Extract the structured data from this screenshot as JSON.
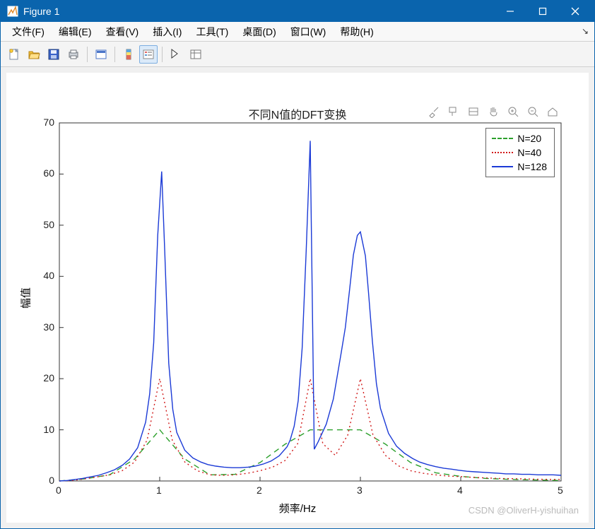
{
  "window": {
    "title": "Figure 1"
  },
  "menu": {
    "items": [
      "文件(F)",
      "编辑(E)",
      "查看(V)",
      "插入(I)",
      "工具(T)",
      "桌面(D)",
      "窗口(W)",
      "帮助(H)"
    ]
  },
  "toolbar": {
    "buttons": [
      {
        "name": "new-figure",
        "title": "New Figure"
      },
      {
        "name": "open",
        "title": "Open"
      },
      {
        "name": "save",
        "title": "Save"
      },
      {
        "name": "print",
        "title": "Print"
      },
      {
        "sep": true
      },
      {
        "name": "link-plot",
        "title": "Link Plot"
      },
      {
        "sep": true
      },
      {
        "name": "insert-colorbar",
        "title": "Insert Colorbar"
      },
      {
        "name": "insert-legend",
        "title": "Insert Legend",
        "active": true
      },
      {
        "sep": true
      },
      {
        "name": "edit-plot",
        "title": "Edit Plot"
      },
      {
        "name": "open-property-inspector",
        "title": "Open Property Inspector"
      }
    ]
  },
  "chart_data": {
    "type": "line",
    "title": "不同N值的DFT变换",
    "xlabel": "频率/Hz",
    "ylabel": "幅值",
    "xlim": [
      0,
      5
    ],
    "ylim": [
      0,
      70
    ],
    "xticks": [
      0,
      1,
      2,
      3,
      4,
      5
    ],
    "yticks": [
      0,
      10,
      20,
      30,
      40,
      50,
      60,
      70
    ],
    "legend": {
      "position": "northeast",
      "entries": [
        "N=20",
        "N=40",
        "N=128"
      ]
    },
    "series": [
      {
        "name": "N=20",
        "color": "#2ca02c",
        "style": "dashed",
        "x": [
          0,
          0.25,
          0.5,
          0.75,
          1,
          1.25,
          1.5,
          1.75,
          2,
          2.25,
          2.5,
          2.75,
          3,
          3.25,
          3.5,
          3.75,
          4,
          4.25,
          4.5,
          4.75,
          5
        ],
        "values": [
          0,
          0.4,
          1.2,
          4.3,
          10,
          4.3,
          1.2,
          1.3,
          3.6,
          7.2,
          10,
          10,
          10,
          7.2,
          3.6,
          1.6,
          0.9,
          0.5,
          0.3,
          0.2,
          0.1
        ]
      },
      {
        "name": "N=40",
        "color": "#d11919",
        "style": "dotted",
        "x": [
          0,
          0.125,
          0.25,
          0.375,
          0.5,
          0.625,
          0.75,
          0.875,
          1,
          1.125,
          1.25,
          1.375,
          1.5,
          1.625,
          1.75,
          1.875,
          2,
          2.125,
          2.25,
          2.375,
          2.5,
          2.625,
          2.75,
          2.875,
          3,
          3.125,
          3.25,
          3.375,
          3.5,
          3.625,
          3.75,
          3.875,
          4,
          4.125,
          4.25,
          4.375,
          4.5,
          4.625,
          4.75,
          4.875,
          5
        ],
        "values": [
          0,
          0.1,
          0.4,
          0.8,
          1.2,
          2,
          3.7,
          8,
          20,
          8,
          3.7,
          2,
          1.2,
          1.1,
          1.2,
          1.5,
          2,
          2.7,
          4,
          7.3,
          20,
          7.3,
          5,
          9,
          20,
          9,
          5,
          3,
          2,
          1.5,
          1.2,
          0.95,
          0.85,
          0.7,
          0.6,
          0.5,
          0.45,
          0.4,
          0.35,
          0.3,
          0.3
        ]
      },
      {
        "name": "N=128",
        "color": "#1b3ad6",
        "style": "solid",
        "x": [
          0,
          0.08,
          0.16,
          0.23,
          0.31,
          0.39,
          0.47,
          0.55,
          0.63,
          0.7,
          0.78,
          0.86,
          0.9,
          0.94,
          0.98,
          1.02,
          1.05,
          1.09,
          1.13,
          1.17,
          1.25,
          1.33,
          1.41,
          1.48,
          1.56,
          1.64,
          1.72,
          1.8,
          1.88,
          1.95,
          2.03,
          2.11,
          2.19,
          2.27,
          2.3,
          2.34,
          2.38,
          2.42,
          2.46,
          2.5,
          2.54,
          2.58,
          2.66,
          2.73,
          2.81,
          2.85,
          2.89,
          2.93,
          2.97,
          3,
          3.05,
          3.08,
          3.12,
          3.16,
          3.2,
          3.28,
          3.36,
          3.44,
          3.52,
          3.59,
          3.67,
          3.75,
          3.83,
          3.91,
          3.98,
          4.06,
          4.14,
          4.22,
          4.3,
          4.38,
          4.45,
          4.53,
          4.61,
          4.69,
          4.77,
          4.84,
          4.92,
          5
        ],
        "values": [
          0,
          0.1,
          0.3,
          0.5,
          0.8,
          1.1,
          1.6,
          2.2,
          3.1,
          4.3,
          6.5,
          11.5,
          17,
          27,
          48,
          60.5,
          45,
          23,
          14,
          9.5,
          6,
          4.5,
          3.7,
          3.2,
          2.9,
          2.7,
          2.6,
          2.6,
          2.7,
          2.9,
          3.3,
          3.9,
          4.9,
          6.7,
          8,
          10.7,
          15.7,
          26,
          45,
          66.5,
          6.2,
          7.7,
          11.1,
          16,
          25.2,
          30,
          37,
          44.2,
          48,
          48.7,
          44,
          37,
          27.3,
          19,
          14.2,
          9.3,
          6.8,
          5.4,
          4.4,
          3.7,
          3.2,
          2.8,
          2.5,
          2.3,
          2.1,
          1.9,
          1.8,
          1.7,
          1.6,
          1.5,
          1.4,
          1.4,
          1.3,
          1.3,
          1.2,
          1.2,
          1.2,
          1.1
        ]
      }
    ]
  },
  "watermark": "CSDN @OliverH-yishuihan"
}
